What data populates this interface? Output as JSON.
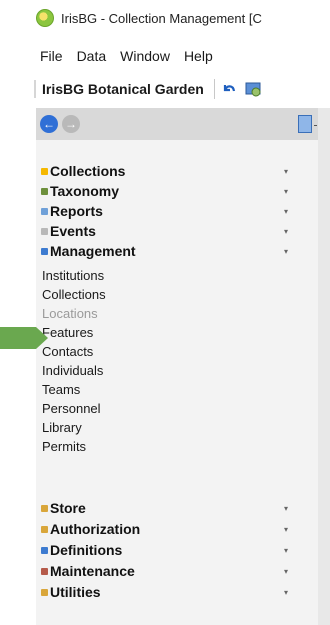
{
  "window": {
    "title": "IrisBG - Collection Management [C"
  },
  "menu": [
    "File",
    "Data",
    "Window",
    "Help"
  ],
  "toolbar": {
    "garden": "IrisBG Botanical Garden"
  },
  "sections_top": [
    {
      "label": "Collections",
      "icon_color": "#f5b800"
    },
    {
      "label": "Taxonomy",
      "icon_color": "#6d8f3b"
    },
    {
      "label": "Reports",
      "icon_color": "#6fa0d8"
    },
    {
      "label": "Events",
      "icon_color": "#b8b8b8"
    },
    {
      "label": "Management",
      "icon_color": "#3d7bd0"
    }
  ],
  "management_items": [
    "Institutions",
    "Collections",
    "Locations",
    "Features",
    "Contacts",
    "Individuals",
    "Teams",
    "Personnel",
    "Library",
    "Permits"
  ],
  "selected_item": "Locations",
  "sections_bottom": [
    {
      "label": "Store",
      "icon_color": "#d9a63a"
    },
    {
      "label": "Authorization",
      "icon_color": "#d9a63a"
    },
    {
      "label": "Definitions",
      "icon_color": "#3d7bd0"
    },
    {
      "label": "Maintenance",
      "icon_color": "#b55a4a"
    },
    {
      "label": "Utilities",
      "icon_color": "#d9a63a"
    }
  ],
  "chevron_glyph": "▾"
}
